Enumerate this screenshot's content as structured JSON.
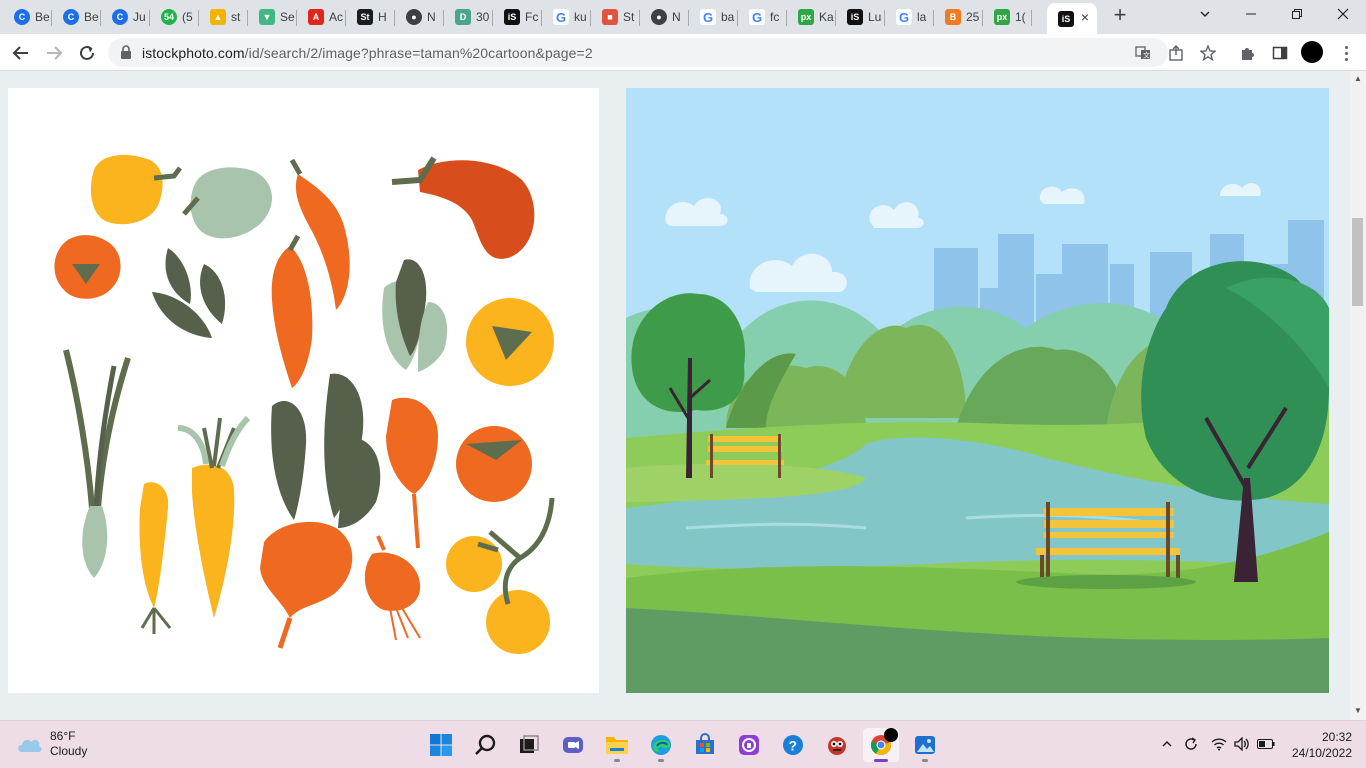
{
  "browser": {
    "tabs": [
      {
        "label": "Be",
        "icon": "canva-icon",
        "color": "#1c6fe8",
        "glyph": "C"
      },
      {
        "label": "Be",
        "icon": "canva-icon",
        "color": "#1c6fe8",
        "glyph": "C"
      },
      {
        "label": "Ju",
        "icon": "canva-icon",
        "color": "#1c6fe8",
        "glyph": "C"
      },
      {
        "label": "(5",
        "icon": "whatsapp-badge-icon",
        "color": "#21b24a",
        "glyph": "54"
      },
      {
        "label": "st",
        "icon": "google-drive-icon",
        "color": "#f2b400",
        "glyph": "▲"
      },
      {
        "label": "Se",
        "icon": "vue-icon",
        "color": "#41b883",
        "glyph": "▼"
      },
      {
        "label": "Ac",
        "icon": "adobe-icon",
        "color": "#e1251b",
        "glyph": "A"
      },
      {
        "label": "H",
        "icon": "shutterstock-icon",
        "color": "#1c1c1c",
        "glyph": "St"
      },
      {
        "label": "N",
        "icon": "github-icon",
        "color": "#3c4043",
        "glyph": "●"
      },
      {
        "label": "30",
        "icon": "dreamstime-icon",
        "color": "#4ba58b",
        "glyph": "D"
      },
      {
        "label": "Fc",
        "icon": "istock-icon",
        "color": "#111111",
        "glyph": "iS"
      },
      {
        "label": "ku",
        "icon": "google-icon",
        "color": "#ffffff",
        "glyph": "G"
      },
      {
        "label": "St",
        "icon": "chat-icon",
        "color": "#e0533f",
        "glyph": "■"
      },
      {
        "label": "N",
        "icon": "github-icon",
        "color": "#3c4043",
        "glyph": "●"
      },
      {
        "label": "ba",
        "icon": "google-icon",
        "color": "#ffffff",
        "glyph": "G"
      },
      {
        "label": "fc",
        "icon": "google-icon",
        "color": "#ffffff",
        "glyph": "G"
      },
      {
        "label": "Ka",
        "icon": "pixabay-icon",
        "color": "#2ea844",
        "glyph": "px"
      },
      {
        "label": "Lu",
        "icon": "istock-icon",
        "color": "#111111",
        "glyph": "iS"
      },
      {
        "label": "la",
        "icon": "google-icon",
        "color": "#ffffff",
        "glyph": "G"
      },
      {
        "label": "25",
        "icon": "blogger-icon",
        "color": "#f47a20",
        "glyph": "B"
      },
      {
        "label": "1(",
        "icon": "pixabay-icon",
        "color": "#2ea844",
        "glyph": "px"
      }
    ],
    "active_tab": {
      "icon": "istock-icon",
      "glyph": "iS",
      "close": "×"
    },
    "new_tab": "+",
    "url_host": "istockphoto.com",
    "url_path": "/id/search/2/image?phrase=taman%20cartoon&page=2"
  },
  "taskbar": {
    "weather_temp": "86°F",
    "weather_desc": "Cloudy",
    "time": "20:32",
    "date": "24/10/2022"
  },
  "colors": {
    "accent": "#7b3fd0",
    "sky": "#b2e1f9",
    "grass": "#79bf4a"
  }
}
